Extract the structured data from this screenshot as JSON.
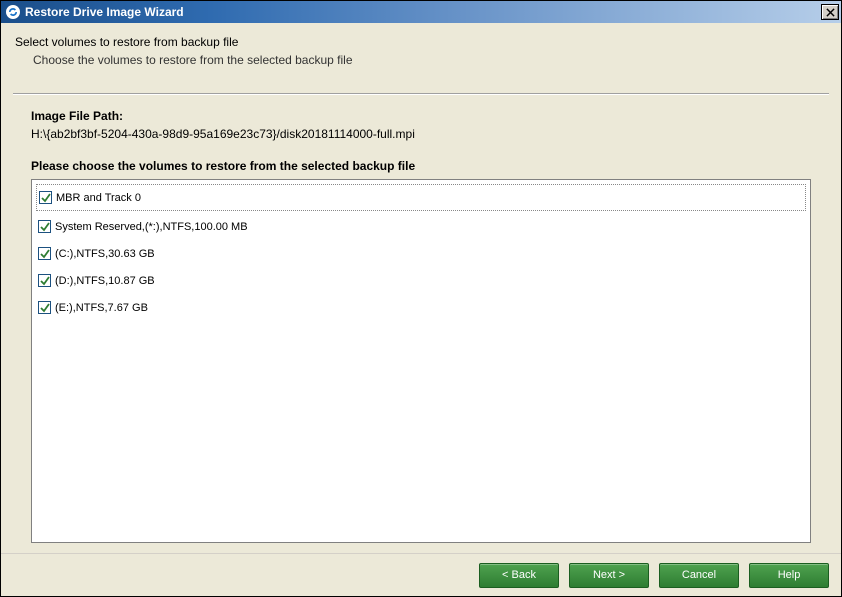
{
  "window": {
    "title": "Restore Drive Image Wizard"
  },
  "header": {
    "title": "Select volumes to restore from backup file",
    "subtitle": "Choose the volumes to restore from the selected backup file"
  },
  "image_path": {
    "label": "Image File Path:",
    "value": "H:\\{ab2bf3bf-5204-430a-98d9-95a169e23c73}/disk20181114000-full.mpi"
  },
  "choose_label": "Please choose the volumes to restore from the selected backup file",
  "volumes": [
    {
      "label": "MBR and Track 0",
      "checked": true
    },
    {
      "label": "System Reserved,(*:),NTFS,100.00 MB",
      "checked": true
    },
    {
      "label": "(C:),NTFS,30.63 GB",
      "checked": true
    },
    {
      "label": "(D:),NTFS,10.87 GB",
      "checked": true
    },
    {
      "label": "(E:),NTFS,7.67 GB",
      "checked": true
    }
  ],
  "buttons": {
    "back": "< Back",
    "next": "Next >",
    "cancel": "Cancel",
    "help": "Help"
  }
}
